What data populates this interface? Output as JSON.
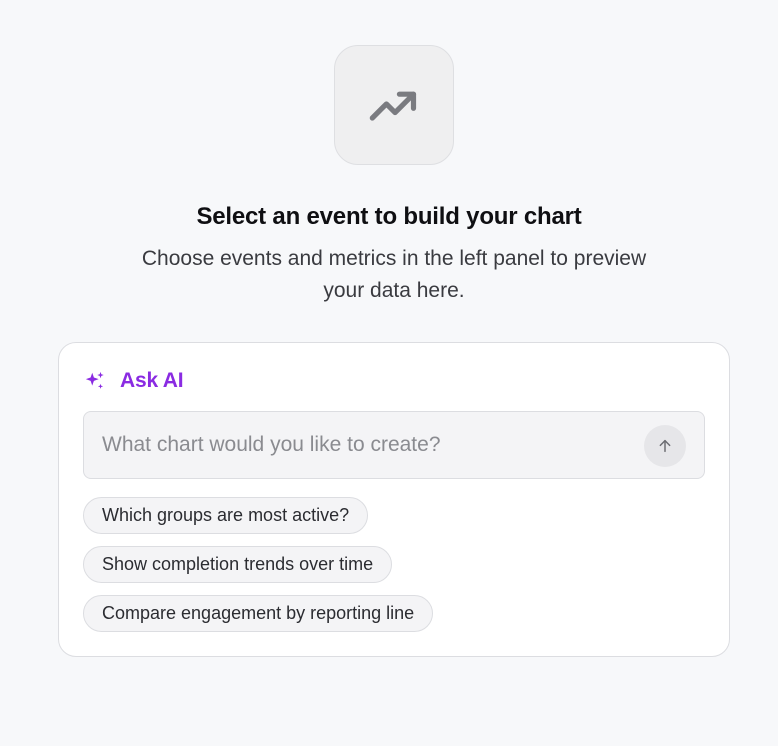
{
  "hero": {
    "icon": "trending-up-icon",
    "title": "Select an event to build your chart",
    "subtitle": "Choose events and metrics in the left panel to preview your data here."
  },
  "ask_ai": {
    "icon": "sparkle-icon",
    "title": "Ask AI",
    "accent_color": "#8a2be2",
    "input_placeholder": "What chart would you like to create?",
    "input_value": "",
    "send_icon": "arrow-up-icon",
    "suggestions": [
      "Which groups are most active?",
      "Show completion trends over time",
      "Compare engagement by reporting line"
    ]
  }
}
